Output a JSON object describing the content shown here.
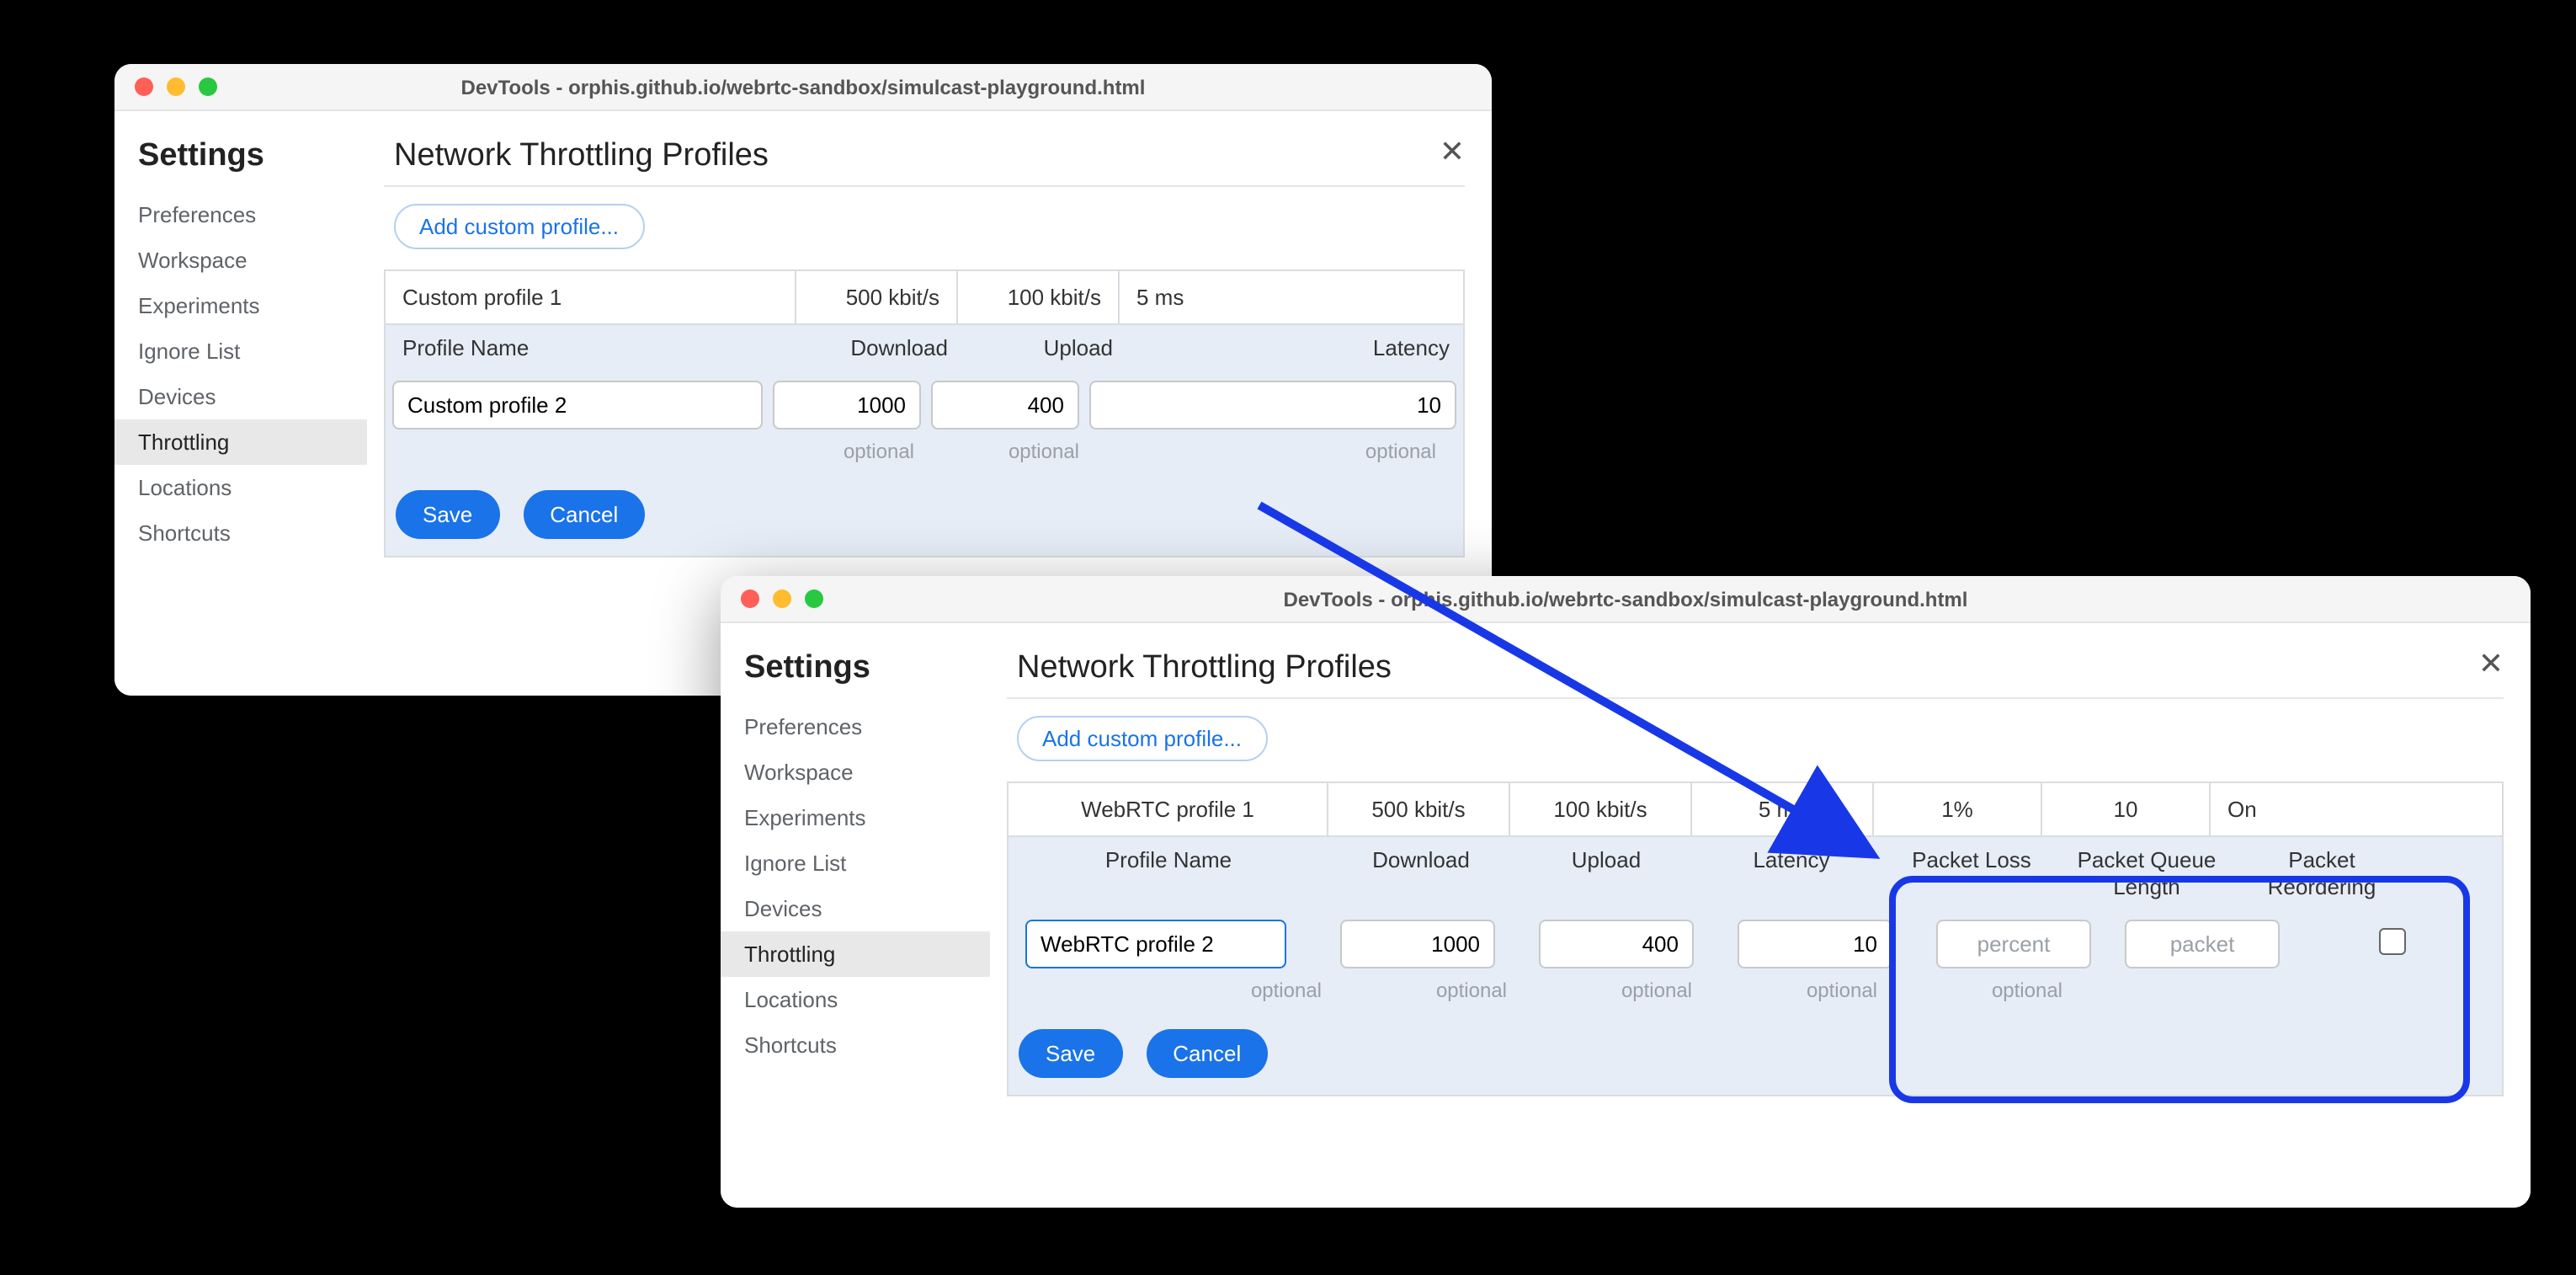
{
  "window_title": "DevTools - orphis.github.io/webrtc-sandbox/simulcast-playground.html",
  "settings_header": "Settings",
  "sidebar": {
    "items": [
      "Preferences",
      "Workspace",
      "Experiments",
      "Ignore List",
      "Devices",
      "Throttling",
      "Locations",
      "Shortcuts"
    ],
    "active_index": 5
  },
  "section_title": "Network Throttling Profiles",
  "add_button": "Add custom profile...",
  "buttons": {
    "save": "Save",
    "cancel": "Cancel"
  },
  "hint_optional": "optional",
  "window1": {
    "row": {
      "name": "Custom profile 1",
      "download": "500 kbit/s",
      "upload": "100 kbit/s",
      "latency": "5 ms"
    },
    "headers": {
      "name": "Profile Name",
      "download": "Download",
      "upload": "Upload",
      "latency": "Latency"
    },
    "inputs": {
      "name": "Custom profile 2",
      "download": "1000",
      "upload": "400",
      "latency": "10"
    }
  },
  "window2": {
    "row": {
      "name": "WebRTC profile 1",
      "download": "500 kbit/s",
      "upload": "100 kbit/s",
      "latency": "5 ms",
      "packet_loss": "1%",
      "packet_queue": "10",
      "reordering": "On"
    },
    "headers": {
      "name": "Profile Name",
      "download": "Download",
      "upload": "Upload",
      "latency": "Latency",
      "packet_loss": "Packet Loss",
      "packet_queue": "Packet Queue Length",
      "reordering": "Packet Reordering"
    },
    "inputs": {
      "name": "WebRTC profile 2",
      "download": "1000",
      "upload": "400",
      "latency": "10",
      "packet_loss_ph": "percent",
      "packet_queue_ph": "packet",
      "reordering_checked": false
    }
  }
}
